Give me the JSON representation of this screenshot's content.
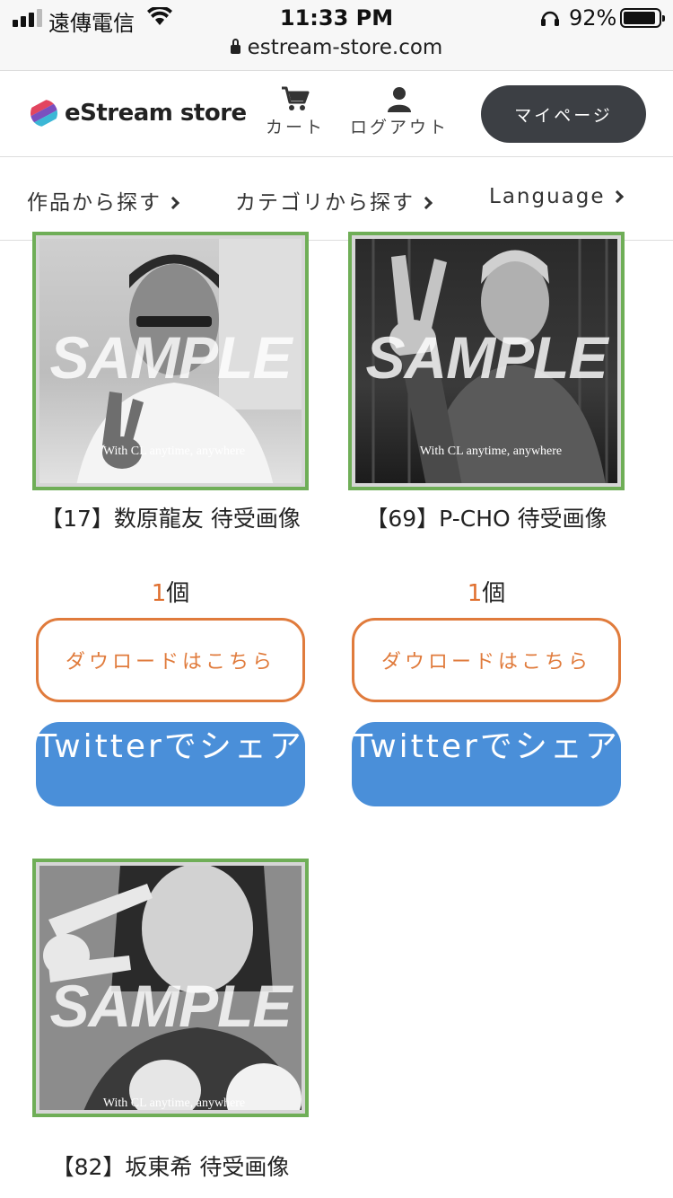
{
  "status_bar": {
    "carrier": "遠傳電信",
    "time": "11:33 PM",
    "battery_pct": "92%",
    "battery_level": 0.92,
    "url": "estream-store.com"
  },
  "header": {
    "logo_text": "eStream store",
    "cart_label": "カート",
    "logout_label": "ログアウト",
    "mypage_label": "マイページ"
  },
  "nav": {
    "items": [
      {
        "label": "作品から探す"
      },
      {
        "label": "カテゴリから探す"
      },
      {
        "label": "Language"
      }
    ]
  },
  "colors": {
    "accent_orange": "#e07b3c",
    "twitter_blue": "#4a8fd9",
    "thumb_border_green": "#6fae57",
    "mypage_dark": "#3c3f44"
  },
  "products": [
    {
      "title": "【17】数原龍友 待受画像",
      "count_num": "1",
      "count_unit": "個",
      "sample_text": "SAMPLE",
      "caption": "With CL anytime, anywhere",
      "download_label": "ダウロードはこちら",
      "share_label": "Twitterでシェア"
    },
    {
      "title": "【69】P-CHO 待受画像",
      "count_num": "1",
      "count_unit": "個",
      "sample_text": "SAMPLE",
      "caption": "With CL anytime, anywhere",
      "download_label": "ダウロードはこちら",
      "share_label": "Twitterでシェア"
    },
    {
      "title": "【82】坂東希 待受画像",
      "sample_text": "SAMPLE",
      "caption": "With CL anytime, anywhere"
    }
  ]
}
